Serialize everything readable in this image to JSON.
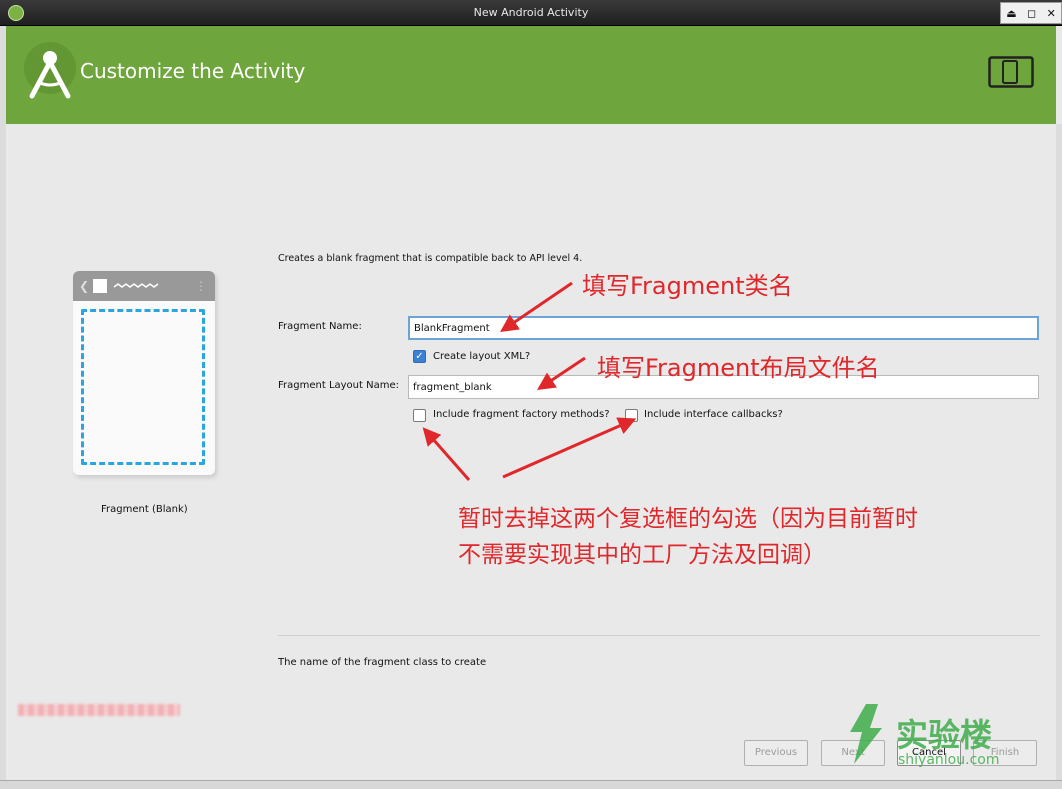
{
  "window": {
    "title": "New Android Activity"
  },
  "banner": {
    "title": "Customize the Activity"
  },
  "template": {
    "name": "Fragment (Blank)"
  },
  "form": {
    "description": "Creates a blank fragment that is compatible back to API level 4.",
    "fragment_name_label": "Fragment Name:",
    "fragment_name_value": "BlankFragment",
    "create_layout_label": "Create layout XML?",
    "create_layout_checked": true,
    "layout_name_label": "Fragment Layout Name:",
    "layout_name_value": "fragment_blank",
    "factory_label": "Include fragment factory methods?",
    "factory_checked": false,
    "callbacks_label": "Include interface callbacks?",
    "callbacks_checked": false,
    "help_text": "The name of the fragment class to create"
  },
  "annotations": {
    "name_note": "填写Fragment类名",
    "layout_note": "填写Fragment布局文件名",
    "checkbox_note_line1": "暂时去掉这两个复选框的勾选（因为目前暂时",
    "checkbox_note_line2": "不需要实现其中的工厂方法及回调）"
  },
  "buttons": {
    "previous": "Previous",
    "next": "Next",
    "cancel": "Cancel",
    "finish": "Finish"
  },
  "watermark": {
    "cn": "实验楼",
    "en": "shiyanlou.com"
  },
  "colors": {
    "banner": "#6fa53d",
    "annotation": "#e0282c",
    "dash": "#29a5e0"
  }
}
